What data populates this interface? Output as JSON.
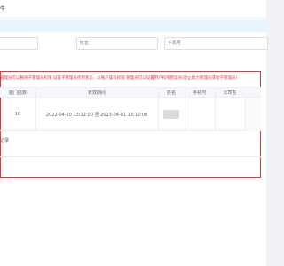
{
  "title": "牛",
  "filters": {
    "left_placeholder": "",
    "name_placeholder": "姓名",
    "phone_placeholder": "手机号"
  },
  "note": "管理员可以删除子管理员权限 设置子管理员停用状态 , 以账户操作权限 管理员可以设置用户权限管理员(停止能力管理员或者子管理员)",
  "table": {
    "headers": [
      "能门店数",
      "有效期间",
      "姓名",
      "手机号",
      "公司名"
    ],
    "rows": [
      {
        "count": "10",
        "period": "2022-04-20 13:12:00 至 2023-04-01 13:12:00"
      }
    ]
  },
  "record_link": "记录"
}
